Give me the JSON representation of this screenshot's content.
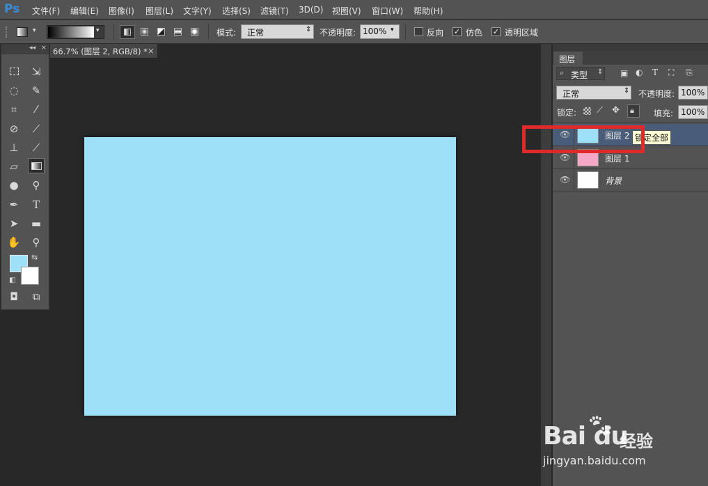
{
  "app": {
    "logo": "Ps"
  },
  "menubar": [
    {
      "label": "文件(F)"
    },
    {
      "label": "编辑(E)"
    },
    {
      "label": "图像(I)"
    },
    {
      "label": "图层(L)"
    },
    {
      "label": "文字(Y)"
    },
    {
      "label": "选择(S)"
    },
    {
      "label": "滤镜(T)"
    },
    {
      "label": "3D(D)"
    },
    {
      "label": "视图(V)"
    },
    {
      "label": "窗口(W)"
    },
    {
      "label": "帮助(H)"
    }
  ],
  "options": {
    "mode_label": "模式:",
    "mode_value": "正常",
    "opacity_label": "不透明度:",
    "opacity_value": "100%",
    "reverse_label": "反向",
    "dither_label": "仿色",
    "transparency_label": "透明区域",
    "reverse_checked": false,
    "dither_checked": true,
    "transparency_checked": true
  },
  "document": {
    "tab_title": "66.7% (图层 2, RGB/8) *",
    "close": "×",
    "canvas_color": "#9ee0f8"
  },
  "toolbox": {
    "collapse_glyph": "◂◂",
    "close_glyph": "×",
    "foreground_color": "#9ee0f8",
    "background_color": "#ffffff"
  },
  "layers_panel": {
    "tab_label": "图层",
    "filter_label": "类型",
    "blend_mode": "正常",
    "opacity_label": "不透明度:",
    "opacity_value": "100%",
    "lock_label": "锁定:",
    "fill_label": "填充:",
    "fill_value": "100%",
    "layers": [
      {
        "name": "图层 2",
        "color": "#9ee0f8",
        "selected": true
      },
      {
        "name": "图层 1",
        "color": "#f5a7c6",
        "selected": false
      },
      {
        "name": "背景",
        "color": "#ffffff",
        "selected": false
      }
    ],
    "tooltip": "锁定全部"
  },
  "watermark": {
    "brand": "Bai du",
    "product": "经验",
    "url": "jingyan.baidu.com"
  }
}
